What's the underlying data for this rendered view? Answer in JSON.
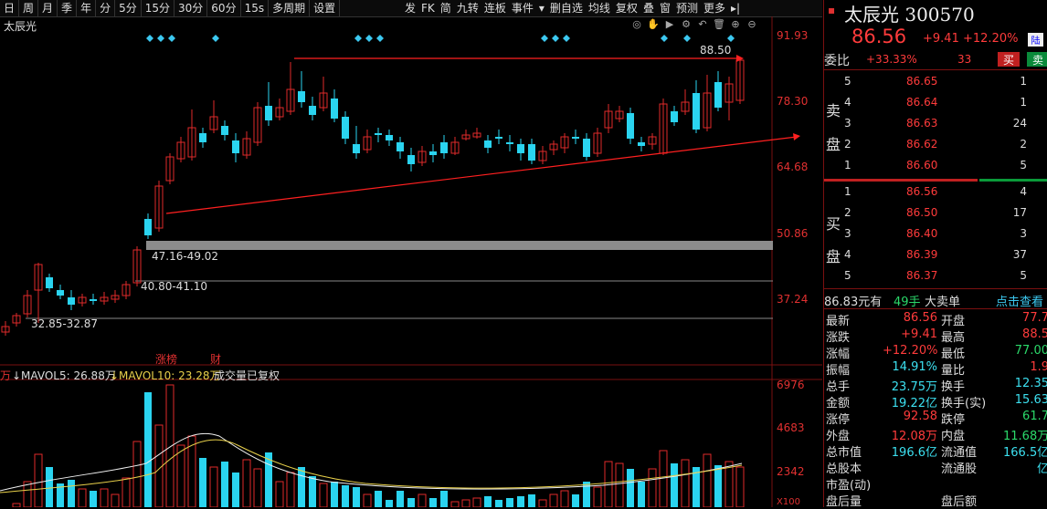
{
  "toolbar": {
    "periods": [
      "日",
      "周",
      "月",
      "季",
      "年",
      "分",
      "5分",
      "15分",
      "30分",
      "60分",
      "15s",
      "多周期",
      "设置"
    ],
    "right_items": [
      "发",
      "FK",
      "简",
      "九转",
      "连板",
      "事件",
      "▾",
      "删自选",
      "均线",
      "复权",
      "叠",
      "窗",
      "预测",
      "更多",
      "▸|"
    ]
  },
  "stock": {
    "name": "太辰光",
    "code": "300570"
  },
  "price_axis": [
    "91.93",
    "78.30",
    "64.68",
    "50.86",
    "37.24"
  ],
  "peak_label": "88.50",
  "support_levels": [
    {
      "label": "47.16-49.02"
    },
    {
      "label": "40.80-41.10"
    },
    {
      "label": "32.85-32.87"
    }
  ],
  "event_labels": [
    "涨榜",
    "财"
  ],
  "volume_header": {
    "vol_prefix": "万",
    "mavol5": "↓MAVOL5: 26.88万",
    "mavol10": "↓MAVOL10: 23.28万",
    "note": "成交量已复权"
  },
  "volume_axis": [
    "6976",
    "4683",
    "2342",
    "X100"
  ],
  "quote": {
    "price": "86.56",
    "change": "+9.41",
    "pct": "+12.20%",
    "badge": "陆",
    "weibi_label": "委比",
    "weibi": "+33.33%",
    "weicha": "33",
    "buy_btn": "买",
    "sell_btn": "卖",
    "sell_side_label": [
      "卖",
      "盘"
    ],
    "buy_side_label": [
      "买",
      "盘"
    ],
    "asks": [
      {
        "lvl": "5",
        "price": "86.65",
        "vol": "1"
      },
      {
        "lvl": "4",
        "price": "86.64",
        "vol": "1"
      },
      {
        "lvl": "3",
        "price": "86.63",
        "vol": "24"
      },
      {
        "lvl": "2",
        "price": "86.62",
        "vol": "2"
      },
      {
        "lvl": "1",
        "price": "86.60",
        "vol": "5"
      }
    ],
    "bids": [
      {
        "lvl": "1",
        "price": "86.56",
        "vol": "4"
      },
      {
        "lvl": "2",
        "price": "86.50",
        "vol": "17"
      },
      {
        "lvl": "3",
        "price": "86.40",
        "vol": "3"
      },
      {
        "lvl": "4",
        "price": "86.39",
        "vol": "37"
      },
      {
        "lvl": "5",
        "price": "86.37",
        "vol": "5"
      }
    ],
    "bigorder": {
      "price": "86.83元有",
      "vol": "49手",
      "label": "大卖单",
      "link": "点击查看"
    },
    "stats": [
      {
        "l": "最新",
        "v": "86.56",
        "c": "red",
        "l2": "开盘",
        "v2": "77.7",
        "c2": "red"
      },
      {
        "l": "涨跌",
        "v": "+9.41",
        "c": "red",
        "l2": "最高",
        "v2": "88.5",
        "c2": "red"
      },
      {
        "l": "涨幅",
        "v": "+12.20%",
        "c": "red",
        "l2": "最低",
        "v2": "77.00",
        "c2": "grn"
      },
      {
        "l": "振幅",
        "v": "14.91%",
        "c": "cyan",
        "l2": "量比",
        "v2": "1.9",
        "c2": "red"
      },
      {
        "l": "总手",
        "v": "23.75万",
        "c": "cyan",
        "l2": "换手",
        "v2": "12.35",
        "c2": "cyan"
      },
      {
        "l": "金额",
        "v": "19.22亿",
        "c": "cyan",
        "l2": "换手(实)",
        "v2": "15.63",
        "c2": "cyan"
      },
      {
        "l": "涨停",
        "v": "92.58",
        "c": "red",
        "l2": "跌停",
        "v2": "61.7",
        "c2": "grn"
      },
      {
        "l": "外盘",
        "v": "12.08万",
        "c": "red",
        "l2": "内盘",
        "v2": "11.68万",
        "c2": "grn"
      },
      {
        "l": "总市值",
        "v": "196.6亿",
        "c": "cyan",
        "l2": "流通值",
        "v2": "166.5亿",
        "c2": "cyan"
      },
      {
        "l": "总股本",
        "v": "",
        "c": "cyan",
        "l2": "流通股",
        "v2": "亿",
        "c2": "cyan"
      },
      {
        "l": "市盈(动)",
        "v": "",
        "c": "cyan",
        "l2": "",
        "v2": "",
        "c2": "cyan"
      },
      {
        "l": "盘后量",
        "v": "",
        "c": "cyan",
        "l2": "盘后额",
        "v2": "",
        "c2": "cyan"
      }
    ]
  },
  "colors": {
    "up": "#e02a2a",
    "down": "#2ad4f0",
    "ma5": "#f0f0f0",
    "ma10": "#e8d04a",
    "trend": "#ff2020",
    "support": "#8c8c8c"
  }
}
